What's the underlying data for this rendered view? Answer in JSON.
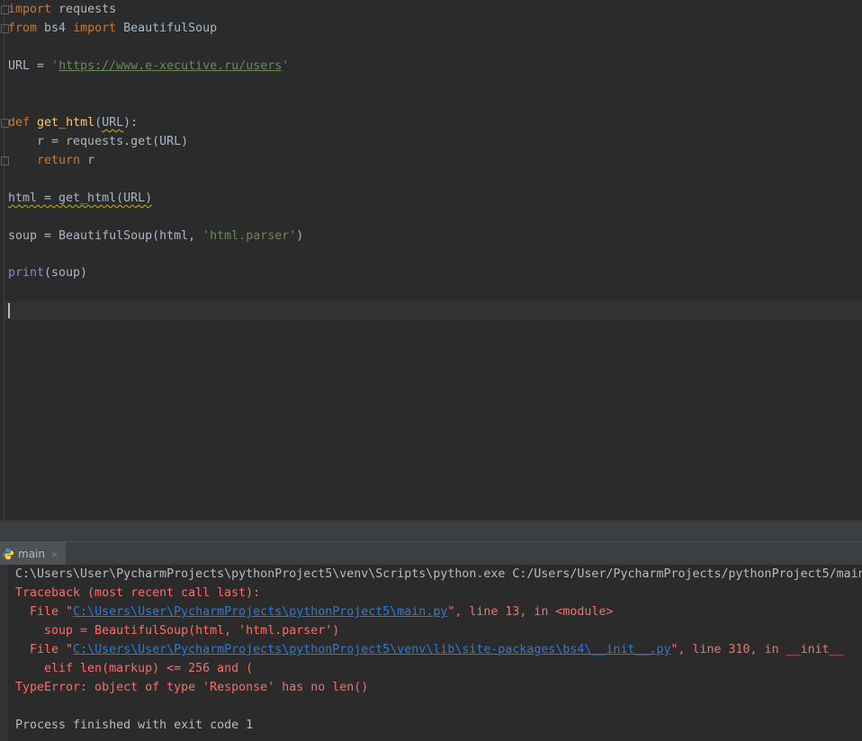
{
  "editor": {
    "line1": {
      "kw": "import",
      "rest": " requests"
    },
    "line2": {
      "kw1": "from",
      "mod": " bs4 ",
      "kw2": "import",
      "rest": " BeautifulSoup"
    },
    "line4": {
      "pre": "URL = ",
      "q1": "'",
      "url": "https://www.e-xecutive.ru/users",
      "q2": "'"
    },
    "line7": {
      "kw": "def",
      "fn": "get_html",
      "p1": "(",
      "param": "URL",
      "p2": "):"
    },
    "line8": {
      "text": "    r = requests.get(URL)"
    },
    "line9": {
      "indent": "    ",
      "kw": "return",
      "rest": " r"
    },
    "line11": {
      "text": "html = get_html(URL)"
    },
    "line13": {
      "pre": "soup = BeautifulSoup(html, ",
      "str": "'html.parser'",
      "post": ")"
    },
    "line15": {
      "builtin": "print",
      "rest": "(soup)"
    }
  },
  "run_tab": {
    "label": "main",
    "close": "×"
  },
  "console": {
    "cmd": "C:\\Users\\User\\PycharmProjects\\pythonProject5\\venv\\Scripts\\python.exe C:/Users/User/PycharmProjects/pythonProject5/main",
    "traceback": "Traceback (most recent call last):",
    "file1_pre": "  File \"",
    "file1_link": "C:\\Users\\User\\PycharmProjects\\pythonProject5\\main.py",
    "file1_post": "\", line 13, in <module>",
    "code1": "    soup = BeautifulSoup(html, 'html.parser')",
    "file2_pre": "  File \"",
    "file2_link": "C:\\Users\\User\\PycharmProjects\\pythonProject5\\venv\\lib\\site-packages\\bs4\\__init__.py",
    "file2_post": "\", line 310, in __init__",
    "code2": "    elif len(markup) <= 256 and (",
    "error": "TypeError: object of type 'Response' has no len()",
    "exit": "Process finished with exit code 1"
  },
  "colors": {
    "background": "#2b2b2b",
    "keyword": "#cc7832",
    "function": "#ffc66d",
    "string": "#6a8759",
    "error": "#ff6b68",
    "link": "#287bde"
  }
}
